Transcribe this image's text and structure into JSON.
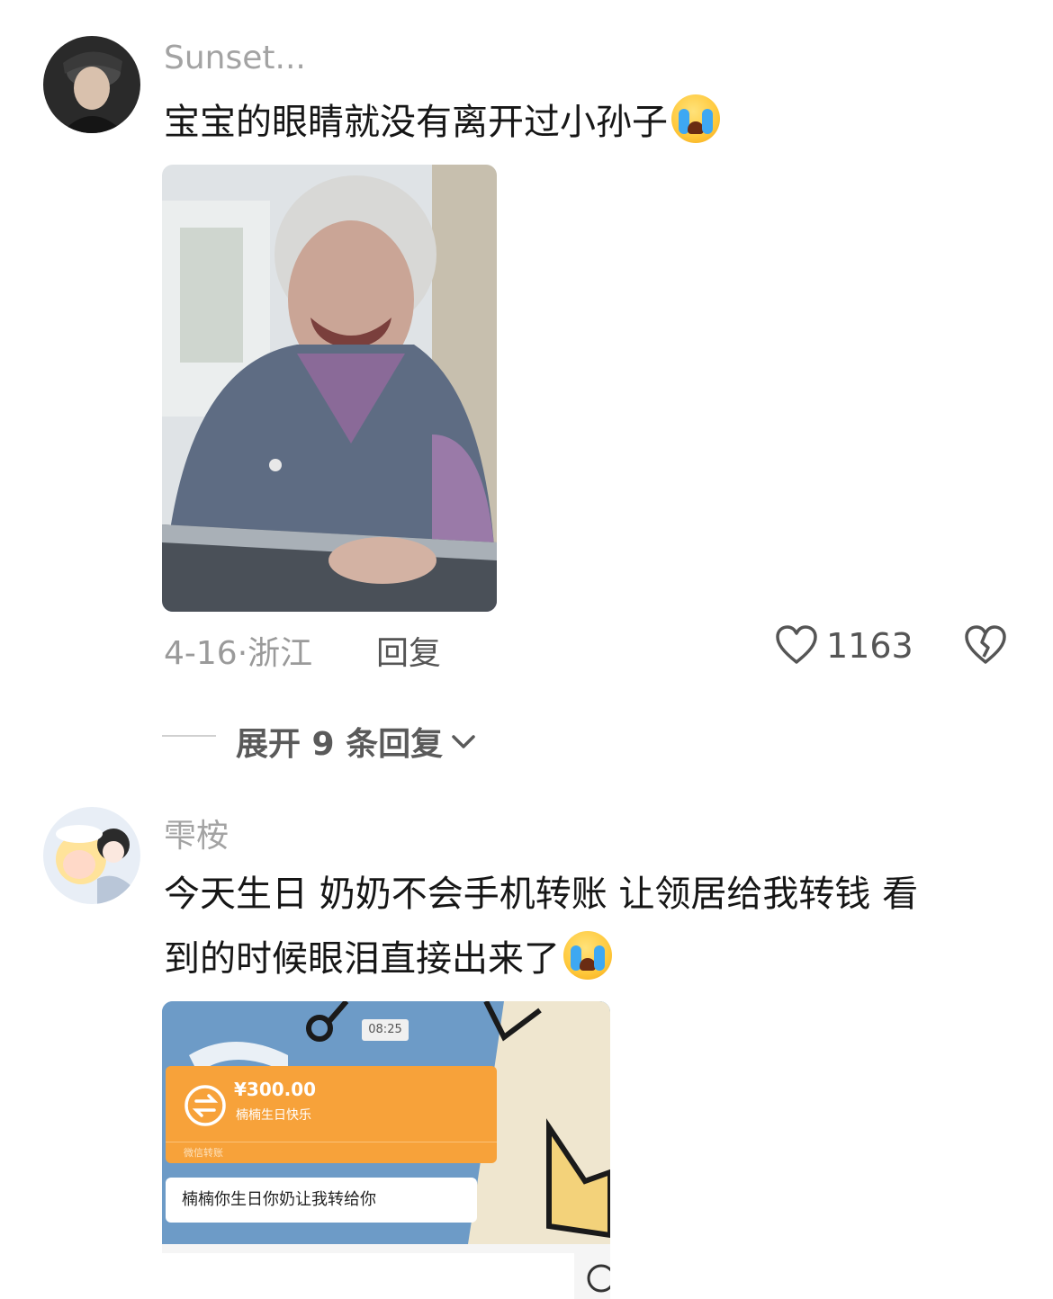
{
  "comments": [
    {
      "username": "Sunset...",
      "text": "宝宝的眼睛就没有离开过小孙子",
      "emoji": "loudly-crying-face",
      "image": "elderly-woman-photo",
      "date": "4-16",
      "location_sep": "·",
      "location": "浙江",
      "reply_label": "回复",
      "likes": "1163",
      "expand_label": "展开 9 条回复"
    },
    {
      "username": "雫桉",
      "text_line1": "今天生日 奶奶不会手机转账 让领居给我转钱 看",
      "text_line2": "到的时候眼泪直接出来了",
      "emoji": "loudly-crying-face",
      "image": "chat-transfer-screenshot",
      "screenshot": {
        "time": "08:25",
        "amount": "¥300.00",
        "transfer_note": "楠楠生日快乐",
        "transfer_label": "微信转账",
        "message": "楠楠你生日你奶让我转给你"
      }
    }
  ],
  "colors": {
    "transfer_orange": "#f7a23a",
    "chat_bg": "#6d9bc7"
  }
}
